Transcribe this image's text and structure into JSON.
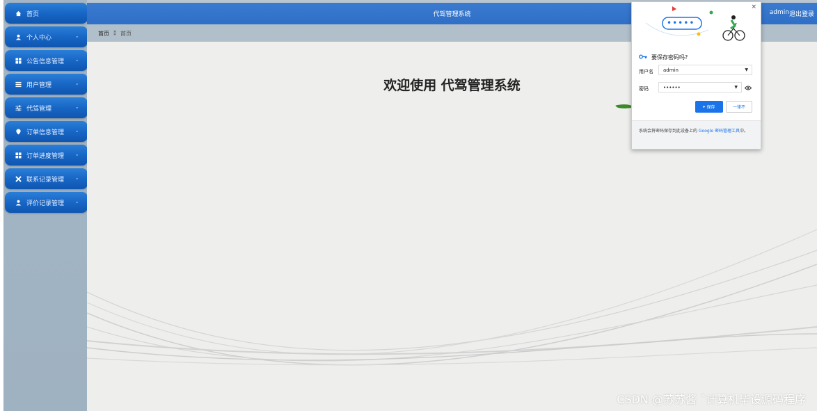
{
  "sidebar": {
    "items": [
      {
        "label": "首页",
        "icon": "home-icon",
        "arrow": ""
      },
      {
        "label": "个人中心",
        "icon": "user-icon",
        "arrow": "⌄"
      },
      {
        "label": "公告信息管理",
        "icon": "grid-icon",
        "arrow": "⌄"
      },
      {
        "label": "用户管理",
        "icon": "list-icon",
        "arrow": "⌄"
      },
      {
        "label": "代驾管理",
        "icon": "sliders-icon",
        "arrow": "⌄"
      },
      {
        "label": "订单信息管理",
        "icon": "pin-icon",
        "arrow": "⌄"
      },
      {
        "label": "订单进度管理",
        "icon": "grid-icon",
        "arrow": "⌄"
      },
      {
        "label": "联系记录管理",
        "icon": "cross-icon",
        "arrow": "⌄"
      },
      {
        "label": "评价记录管理",
        "icon": "user-icon",
        "arrow": "⌄"
      }
    ]
  },
  "header": {
    "title": "代驾管理系统",
    "user": "admin",
    "logout": "退出登录"
  },
  "breadcrumb": {
    "home": "首页",
    "sep": "⁑",
    "current": "首页"
  },
  "main": {
    "welcome": "欢迎使用 代驾管理系统"
  },
  "popup": {
    "close": "×",
    "heading": "要保存密码吗?",
    "username_label": "用户名",
    "username_value": "admin",
    "password_label": "密码",
    "password_value": "••••••",
    "save_button": "保存",
    "never_button": "一律不",
    "footer_text": "系统会将密码保存到此设备上的 ",
    "footer_link": "Google 密码管理工具",
    "footer_tail": "中。",
    "dots": "•••••"
  },
  "watermark": "CSDN @苏苏酱    ˇ计算机毕设源码程序",
  "colors": {
    "menu_blue": "#1664c3",
    "header_blue": "#2f6fc7",
    "popup_accent": "#1a73e8"
  }
}
